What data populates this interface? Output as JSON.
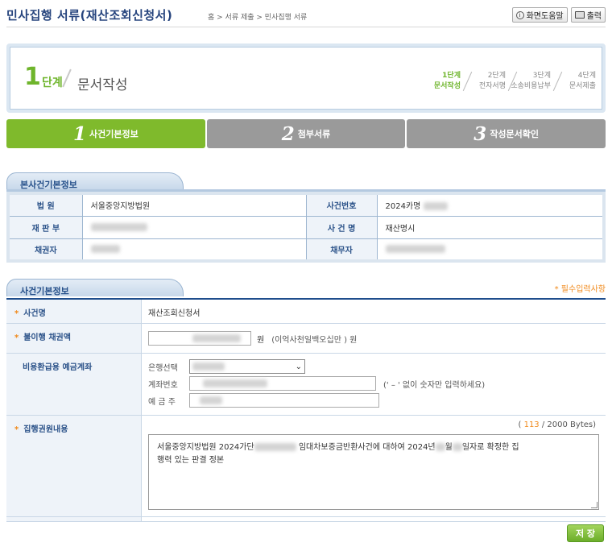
{
  "header": {
    "title": "민사집행 서류(재산조회신청서)",
    "breadcrumb": "홈 > 서류 제출 > 민사집행 서류",
    "help_label": "화면도움말",
    "print_label": "출력"
  },
  "step_box": {
    "number": "1",
    "step_word": "단계",
    "step_name": "문서작성",
    "steps": [
      {
        "line1": "1단계",
        "line2": "문서작성",
        "active": true
      },
      {
        "line1": "2단계",
        "line2": "전자서명",
        "active": false
      },
      {
        "line1": "3단계",
        "line2": "소송비용납부",
        "active": false
      },
      {
        "line1": "4단계",
        "line2": "문서제출",
        "active": false
      }
    ]
  },
  "tabs": [
    {
      "num": "1",
      "label": "사건기본정보"
    },
    {
      "num": "2",
      "label": "첨부서류"
    },
    {
      "num": "3",
      "label": "작성문서확인"
    }
  ],
  "main_case": {
    "title": "본사건기본정보",
    "court_label": "법 원",
    "court_value": "서울중앙지방법원",
    "case_no_label": "사건번호",
    "case_no_value": "2024카명",
    "division_label": "재 판 부",
    "case_name_label": "사 건 명",
    "case_name_value": "재산명시",
    "creditor_label": "채권자",
    "debtor_label": "채무자"
  },
  "form": {
    "title": "사건기본정보",
    "required_note": "* 필수입력사항",
    "case_name_label": "사건명",
    "case_name_value": "재산조회신청서",
    "claim_label": "불이행 채권액",
    "claim_unit": "원",
    "claim_words": "(이억사천일백오십만 ) 원",
    "account_label": "비용환급용 예금계좌",
    "bank_label": "은행선택",
    "account_no_label": "계좌번호",
    "account_note": "(' – ' 없이 숫자만 입력하세요)",
    "holder_label": "예 금 주",
    "content_label": "집행권원내용",
    "byte_count": "113",
    "byte_max": "/ 2000 Bytes)",
    "byte_open": "(",
    "content_text_1": "서울중앙지방법원 2024가단",
    "content_text_2": "임대차보증금반환사건에 대하여 2024년",
    "content_text_3": "월",
    "content_text_4": "일자로 확정한 집",
    "content_text_5": "행력 있는 판결 정본"
  },
  "save_label": "저 장",
  "colors": {
    "accent_green": "#7fba2c",
    "navy": "#27457e",
    "required_orange": "#f08a1c"
  }
}
